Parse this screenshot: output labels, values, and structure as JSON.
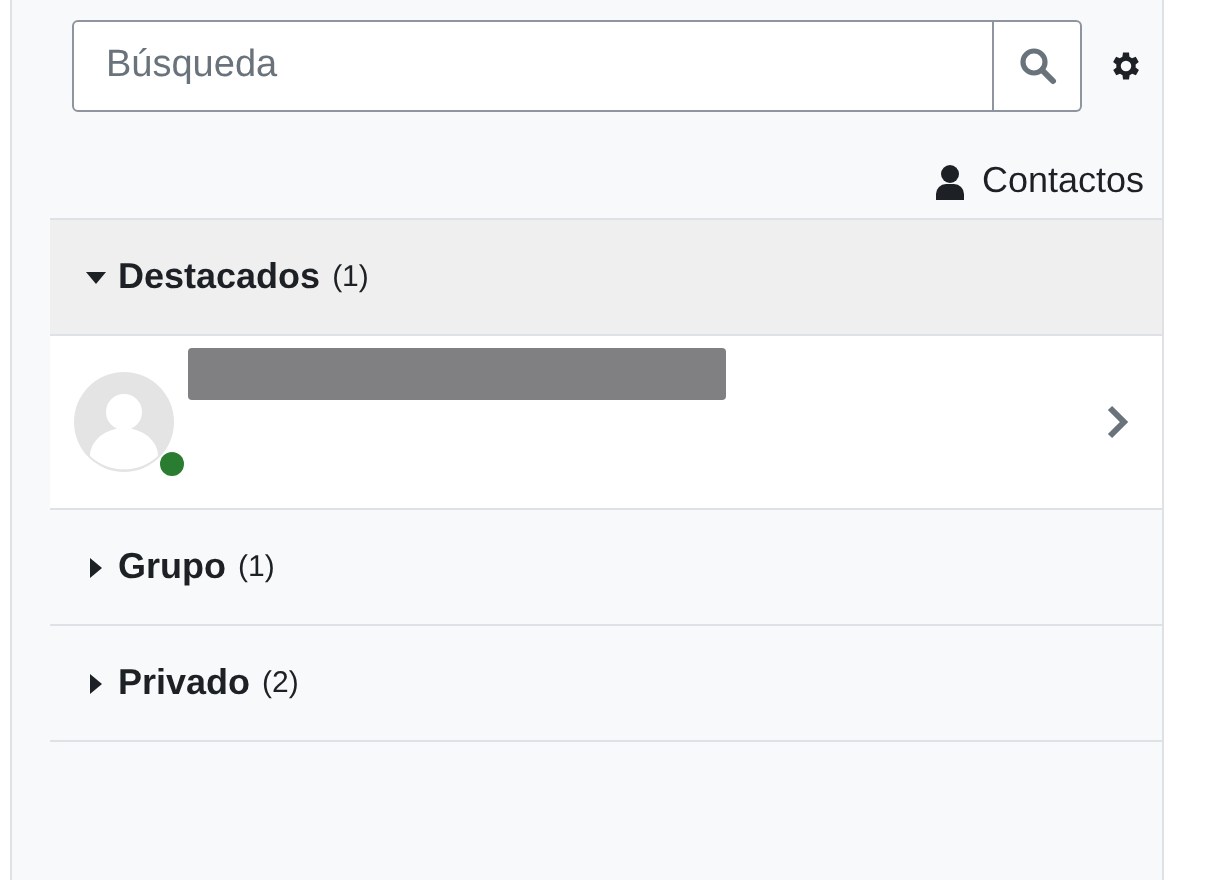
{
  "search": {
    "placeholder": "Búsqueda"
  },
  "contacts_link": {
    "label": "Contactos"
  },
  "sections": [
    {
      "title": "Destacados",
      "count": "(1)",
      "expanded": true,
      "items": [
        {
          "redacted": true,
          "online": true
        }
      ]
    },
    {
      "title": "Grupo",
      "count": "(1)",
      "expanded": false
    },
    {
      "title": "Privado",
      "count": "(2)",
      "expanded": false
    }
  ]
}
